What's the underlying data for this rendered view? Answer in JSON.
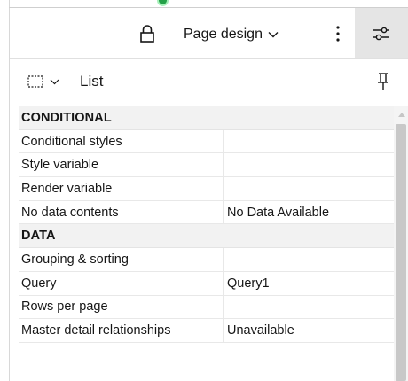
{
  "toolbar": {
    "mode_label": "Page design",
    "icons": {
      "lock": "lock-icon",
      "mode_chevron": "chevron-down-icon",
      "more": "kebab-icon",
      "properties": "sliders-icon"
    }
  },
  "panel": {
    "title": "List",
    "icons": {
      "select": "marquee-select-icon",
      "select_chevron": "chevron-down-icon",
      "pin": "pin-icon"
    }
  },
  "properties": {
    "sections": [
      {
        "name": "CONDITIONAL",
        "rows": [
          {
            "label": "Conditional styles",
            "value": ""
          },
          {
            "label": "Style variable",
            "value": ""
          },
          {
            "label": "Render variable",
            "value": ""
          },
          {
            "label": "No data contents",
            "value": "No Data Available"
          }
        ]
      },
      {
        "name": "DATA",
        "rows": [
          {
            "label": "Grouping & sorting",
            "value": ""
          },
          {
            "label": "Query",
            "value": "Query1"
          },
          {
            "label": "Rows per page",
            "value": ""
          },
          {
            "label": "Master detail relationships",
            "value": "Unavailable"
          }
        ]
      }
    ]
  },
  "colors": {
    "status_dot": "#24a148",
    "section_background": "#f2f2f2",
    "toggle_active_background": "#e5e5e5",
    "text": "#161616"
  }
}
